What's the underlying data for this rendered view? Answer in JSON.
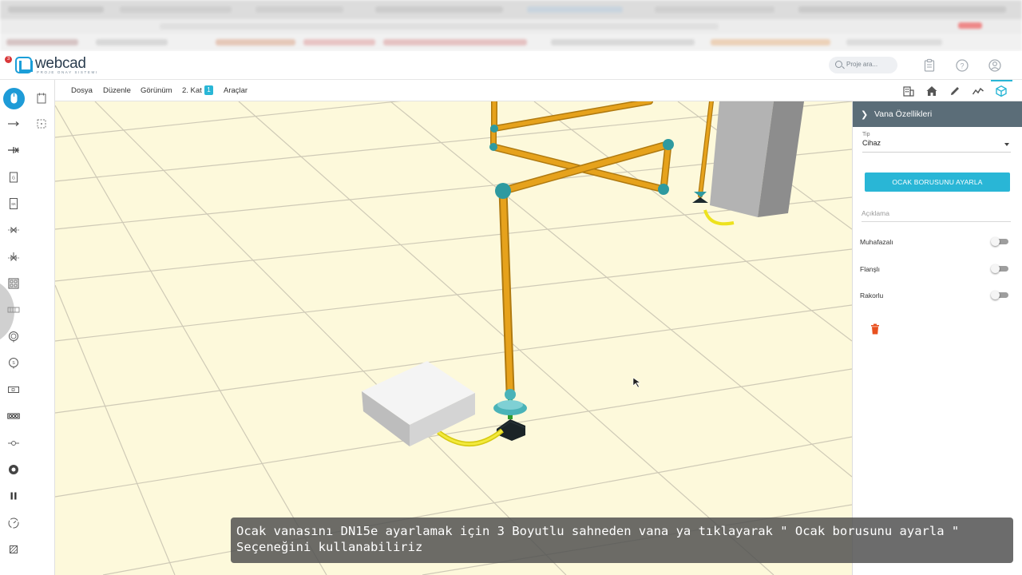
{
  "app": {
    "logo_text": "webcad",
    "logo_subtitle": "PROJE ONAY SISTEMI",
    "notification_count": "3",
    "search_placeholder": "Proje ara..."
  },
  "menu": {
    "items": [
      "Dosya",
      "Düzenle",
      "Görünüm",
      "2. Kat",
      "Araçlar"
    ],
    "floor_badge": "1"
  },
  "view_icons": [
    "building-icon",
    "home-icon",
    "pencil-icon",
    "line-chart-icon",
    "cube-icon"
  ],
  "left_tools": [
    "mouse-icon",
    "arrow-right-icon",
    "pipe-cut-icon",
    "meter-icon",
    "sk-device-icon",
    "valve-icon",
    "regulator-icon",
    "grid-device-icon",
    "panel-icon",
    "gauge-icon",
    "target-icon",
    "radiator-icon",
    "boiler-icon",
    "connector-icon",
    "circle-icon",
    "pause-icon",
    "clock-icon",
    "hatch-icon"
  ],
  "properties": {
    "title": "Vana Özellikleri",
    "type_label": "Tip",
    "type_value": "Cihaz",
    "button_label": "OCAK BORUSUNU AYARLA",
    "description_placeholder": "Açıklama",
    "toggles": [
      {
        "label": "Muhafazalı",
        "on": false
      },
      {
        "label": "Flanşlı",
        "on": false
      },
      {
        "label": "Rakorlu",
        "on": false
      }
    ]
  },
  "caption": {
    "text": "Ocak vanasını DN15e ayarlamak için 3 Boyutlu sahneden vana ya tıklayarak \" Ocak borusunu ayarla \" Seçeneğini kullanabiliriz"
  },
  "colors": {
    "accent": "#29b6d6",
    "panel_header": "#5b6d78",
    "pipe": "#e6a21c",
    "floor": "#fdf9db"
  }
}
